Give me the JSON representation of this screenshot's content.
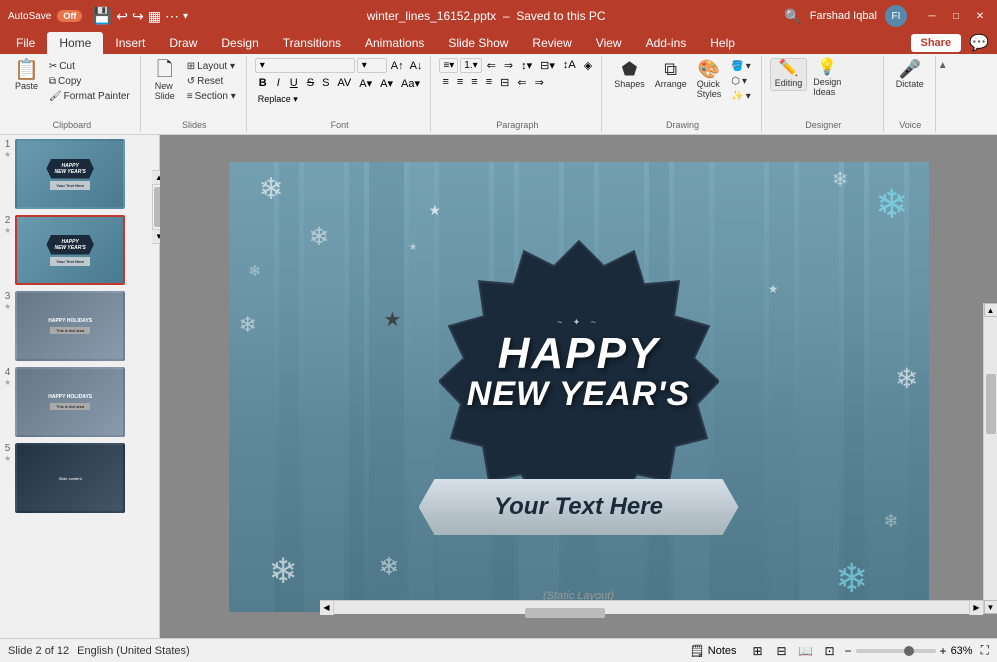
{
  "titlebar": {
    "autosave_label": "AutoSave",
    "autosave_state": "Off",
    "filename": "winter_lines_16152.pptx",
    "save_state": "Saved to this PC",
    "user": "Farshad Iqbal"
  },
  "ribbon": {
    "tabs": [
      "File",
      "Home",
      "Insert",
      "Draw",
      "Design",
      "Transitions",
      "Animations",
      "Slide Show",
      "Review",
      "View",
      "Add-ins",
      "Help"
    ],
    "active_tab": "Home",
    "groups": {
      "clipboard": {
        "label": "Clipboard",
        "buttons": [
          "Paste",
          "Cut",
          "Copy",
          "Format Painter"
        ]
      },
      "slides": {
        "label": "Slides",
        "buttons": [
          "New Slide",
          "Layout",
          "Reset",
          "Section"
        ]
      },
      "font": {
        "label": "Font"
      },
      "paragraph": {
        "label": "Paragraph"
      },
      "drawing": {
        "label": "Drawing",
        "buttons": [
          "Shapes",
          "Arrange",
          "Quick Styles"
        ]
      },
      "designer": {
        "label": "Designer",
        "buttons": [
          "Editing",
          "Design Ideas"
        ]
      },
      "voice": {
        "label": "Voice",
        "buttons": [
          "Dictate"
        ]
      }
    },
    "share_button": "Share",
    "editing_button": "Editing",
    "design_ideas_button": "Design Ideas",
    "dictate_button": "Dictate"
  },
  "slides": [
    {
      "num": "1",
      "starred": true,
      "class": "thumb-slide-1",
      "title": "HAPPY NEW YEAR'S",
      "subtitle": "Your Text Here"
    },
    {
      "num": "2",
      "starred": true,
      "class": "thumb-slide-2",
      "title": "HAPPY NEW YEAR'S",
      "subtitle": "Your Text Here",
      "active": true
    },
    {
      "num": "3",
      "starred": true,
      "class": "thumb-slide-3",
      "title": "HAPPY HOLIDAYS",
      "subtitle": "This is text area"
    },
    {
      "num": "4",
      "starred": true,
      "class": "thumb-slide-4",
      "title": "HAPPY HOLIDAYS",
      "subtitle": "This is text area"
    },
    {
      "num": "5",
      "starred": true,
      "class": "thumb-slide-5",
      "title": "",
      "subtitle": ""
    }
  ],
  "slide": {
    "happy_text_line1": "HAPPY",
    "happy_text_line2": "NEW YEAR'S",
    "your_text": "Your Text Here",
    "static_label": "(Static Layout)"
  },
  "statusbar": {
    "slide_info": "Slide 2 of 12",
    "language": "English (United States)",
    "notes_label": "Notes",
    "zoom_level": "63%"
  }
}
